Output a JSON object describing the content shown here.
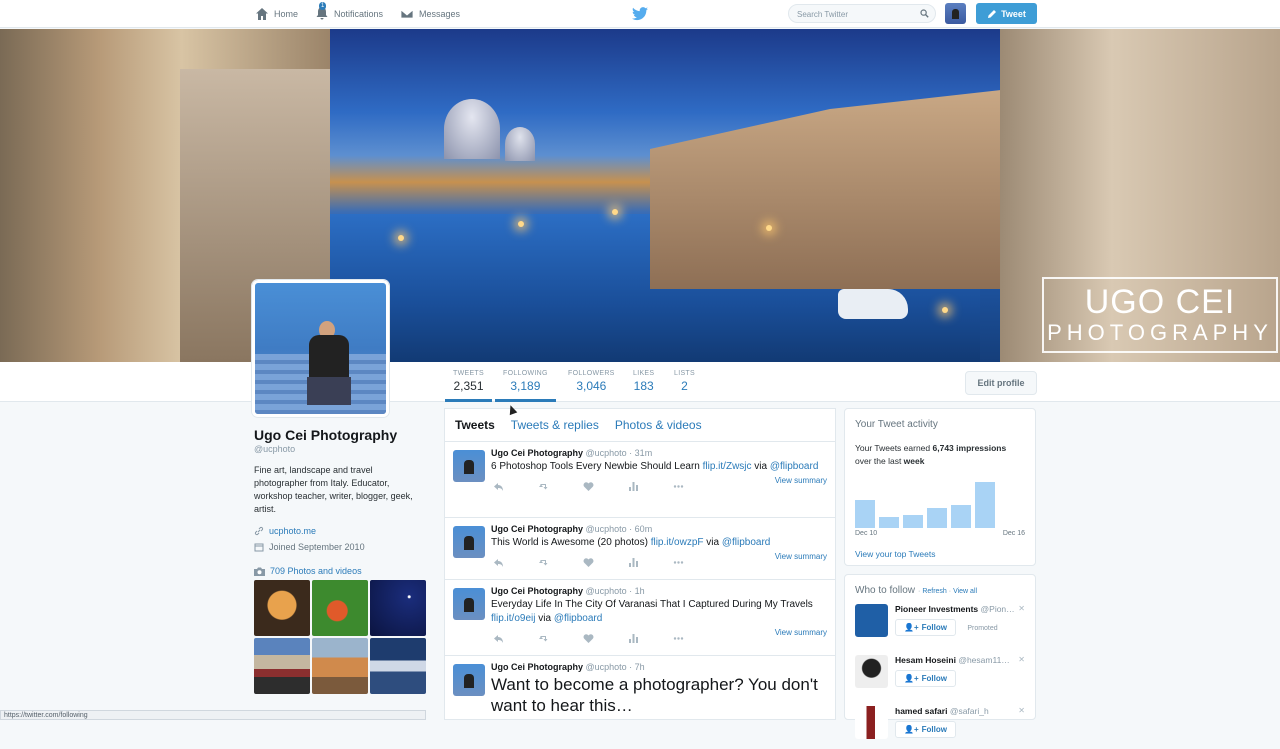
{
  "nav": {
    "home": "Home",
    "notifications": "Notifications",
    "notifications_badge": "1",
    "messages": "Messages",
    "search_placeholder": "Search Twitter",
    "tweet_button": "Tweet"
  },
  "banner": {
    "watermark_line1": "UGO CEI",
    "watermark_line2": "PHOTOGRAPHY"
  },
  "stats": [
    {
      "label": "TWEETS",
      "value": "2,351"
    },
    {
      "label": "FOLLOWING",
      "value": "3,189"
    },
    {
      "label": "FOLLOWERS",
      "value": "3,046"
    },
    {
      "label": "LIKES",
      "value": "183"
    },
    {
      "label": "LISTS",
      "value": "2"
    }
  ],
  "edit_profile": "Edit profile",
  "profile": {
    "name": "Ugo Cei Photography",
    "handle": "@ucphoto",
    "bio": "Fine art, landscape and travel photographer from Italy. Educator, workshop teacher, writer, blogger, geek, artist.",
    "website": "ucphoto.me",
    "joined": "Joined September 2010",
    "photos_link": "709 Photos and videos"
  },
  "tabs": [
    "Tweets",
    "Tweets & replies",
    "Photos & videos"
  ],
  "tweets": [
    {
      "name": "Ugo Cei Photography",
      "meta": "@ucphoto · 31m",
      "text": "6 Photoshop Tools Every Newbie Should Learn ",
      "link": "flip.it/Zwsjc",
      "via": " via ",
      "mention": "@flipboard",
      "summary": "View summary"
    },
    {
      "name": "Ugo Cei Photography",
      "meta": "@ucphoto · 60m",
      "text": "This World is Awesome (20 photos) ",
      "link": "flip.it/owzpF",
      "via": " via ",
      "mention": "@flipboard",
      "summary": "View summary"
    },
    {
      "name": "Ugo Cei Photography",
      "meta": "@ucphoto · 1h",
      "text": "Everyday Life In The City Of Varanasi That I Captured During My Travels ",
      "link": "flip.it/o9eij",
      "via": " via ",
      "mention": "@flipboard",
      "summary": "View summary"
    },
    {
      "name": "Ugo Cei Photography",
      "meta": "@ucphoto · 7h",
      "text": "Want to become a photographer? You don't want to hear this…"
    }
  ],
  "activity": {
    "title": "Your Tweet activity",
    "line1": "Your Tweets earned ",
    "impressions": "6,743 impressions",
    "line2": "over the last ",
    "period": "week",
    "bars": [
      0.55,
      0.22,
      0.25,
      0.4,
      0.45,
      0.92
    ],
    "start_label": "Dec 10",
    "end_label": "Dec 16",
    "link": "View your top Tweets"
  },
  "who_to_follow": {
    "title": "Who to follow",
    "refresh": "Refresh",
    "view_all": "View all",
    "follow_label": "Follow",
    "suggestions": [
      {
        "name": "Pioneer Investments",
        "handle": "@Pion…",
        "promoted": "Promoted"
      },
      {
        "name": "Hesam Hoseini",
        "handle": "@hesam11…"
      },
      {
        "name": "hamed safari",
        "handle": "@safari_h"
      }
    ]
  },
  "statusbar": "https://twitter.com/following"
}
